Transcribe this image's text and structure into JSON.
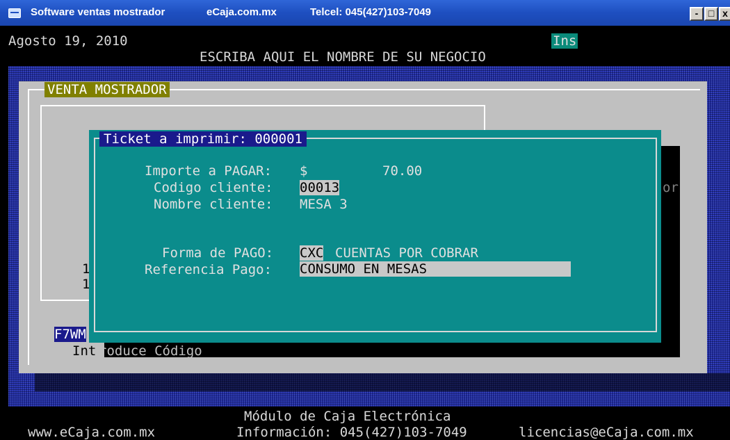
{
  "window": {
    "title": "Software ventas mostrador",
    "site": "eCaja.com.mx",
    "phone": "Telcel: 045(427)103-7049",
    "controls": {
      "minimize": "-",
      "maximize": "□",
      "close": "x"
    }
  },
  "header": {
    "date": "Agosto 19, 2010",
    "business_name": "ESCRIBA AQUI EL NOMBRE DE SU NEGOCIO",
    "mode": "Ins"
  },
  "panel": {
    "title": "VENTA MOSTRADOR",
    "row1": "1",
    "row2": "1",
    "right_fragment": "or",
    "f7_label": "F7WM",
    "prompt_prefix": "Int",
    "prompt_rest": "roduce Código"
  },
  "dialog": {
    "title": "Ticket a imprimir: 000001",
    "importe_label": "Importe a PAGAR:",
    "currency": "$",
    "importe_value": "70.00",
    "codigo_label": "Codigo cliente:",
    "codigo_value": "00013",
    "nombre_label": "Nombre cliente:",
    "nombre_value": "MESA 3",
    "forma_label": "Forma de PAGO:",
    "forma_code": "CXC",
    "forma_desc": "CUENTAS POR COBRAR",
    "referencia_label": "Referencia Pago:",
    "referencia_value": "CONSUMO EN MESAS"
  },
  "footer": {
    "module": "Módulo de Caja Electrónica",
    "website": "www.eCaja.com.mx",
    "info": "Información: 045(427)103-7049",
    "email": "licencias@eCaja.com.mx"
  }
}
